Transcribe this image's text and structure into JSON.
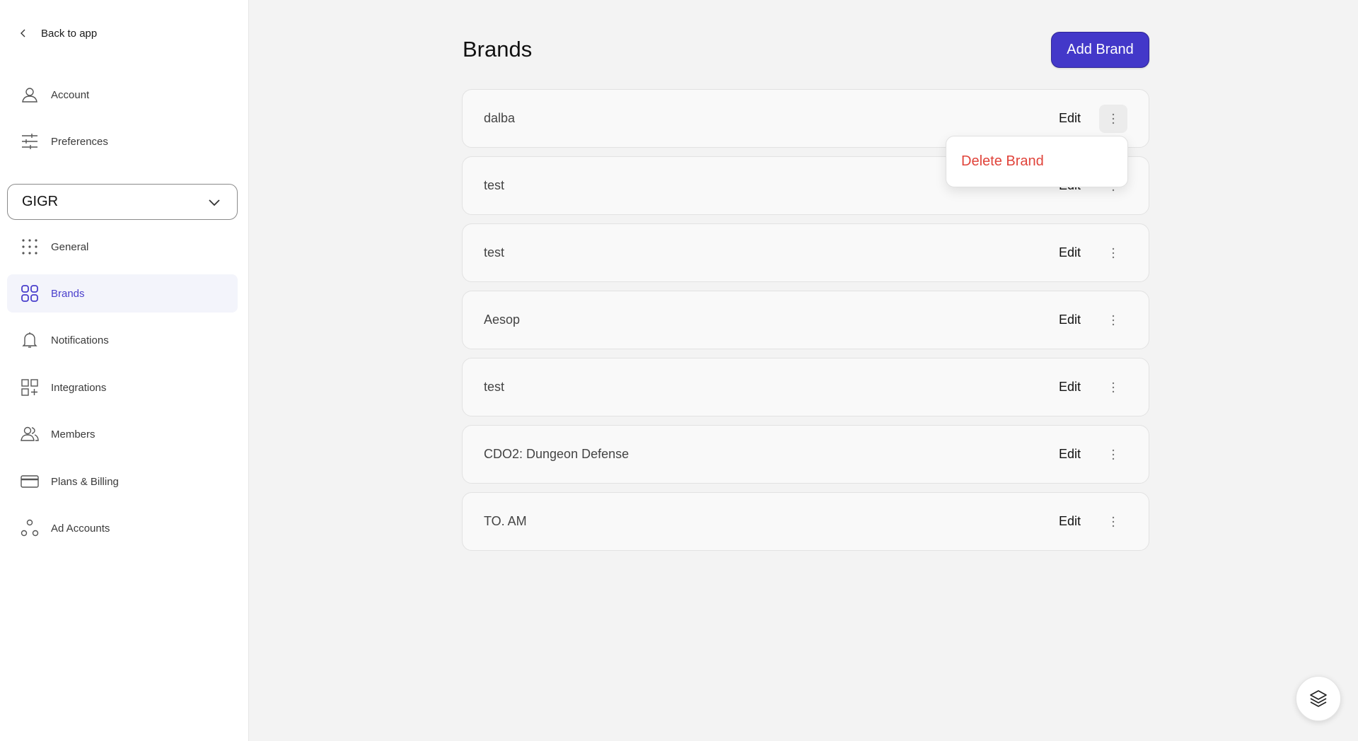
{
  "sidebar": {
    "back_label": "Back to app",
    "top_items": [
      {
        "label": "Account",
        "icon": "user-icon"
      },
      {
        "label": "Preferences",
        "icon": "sliders-icon"
      }
    ],
    "workspace": "GIGR",
    "items": [
      {
        "label": "General",
        "icon": "dots-grid-icon"
      },
      {
        "label": "Brands",
        "icon": "grid-icon",
        "active": true
      },
      {
        "label": "Notifications",
        "icon": "bell-icon"
      },
      {
        "label": "Integrations",
        "icon": "apps-plus-icon"
      },
      {
        "label": "Members",
        "icon": "users-icon"
      },
      {
        "label": "Plans & Billing",
        "icon": "credit-card-icon"
      },
      {
        "label": "Ad Accounts",
        "icon": "nodes-icon"
      }
    ]
  },
  "main": {
    "title": "Brands",
    "add_button": "Add Brand",
    "edit_label": "Edit",
    "brands": [
      "dalba",
      "test",
      "test",
      "Aesop",
      "test",
      "CDO2: Dungeon Defense",
      "TO. AM"
    ],
    "menu": {
      "delete_label": "Delete Brand"
    }
  },
  "colors": {
    "accent": "#4338c9",
    "danger": "#e0433a",
    "active_bg": "#f3f4fb",
    "active_text": "#4a3fcc"
  }
}
